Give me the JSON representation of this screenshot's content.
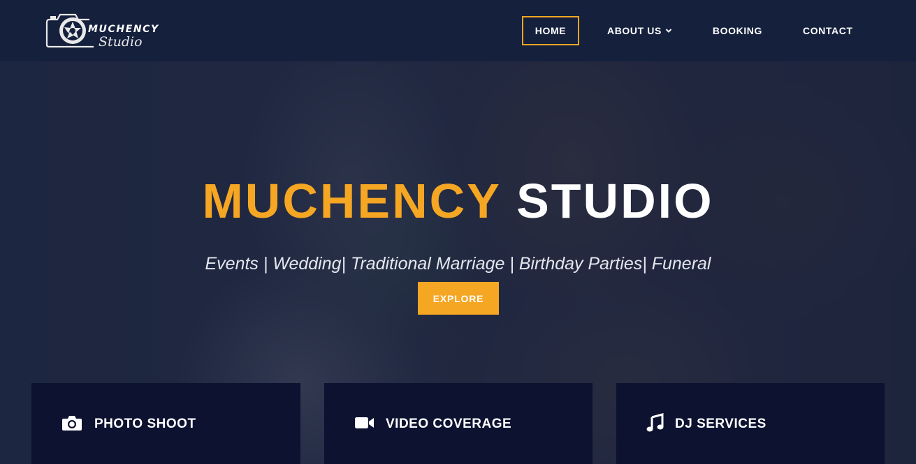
{
  "brand": {
    "wordmark": "MUCHENCY",
    "sub": "Studio"
  },
  "nav": {
    "items": [
      {
        "label": "HOME",
        "active": true
      },
      {
        "label": "ABOUT US",
        "has_dropdown": true
      },
      {
        "label": "BOOKING"
      },
      {
        "label": "CONTACT"
      }
    ]
  },
  "hero": {
    "title_accent": "MUCHENCY",
    "title_plain": "STUDIO",
    "tagline": "Events | Wedding| Traditional Marriage | Birthday Parties| Funeral",
    "cta_label": "EXPLORE"
  },
  "services": [
    {
      "label": "PHOTO SHOOT",
      "icon": "camera-icon"
    },
    {
      "label": "VIDEO COVERAGE",
      "icon": "video-camera-icon"
    },
    {
      "label": "DJ SERVICES",
      "icon": "music-note-icon"
    }
  ],
  "colors": {
    "accent": "#f5a623",
    "header_bg": "#15203d",
    "card_bg": "#0c1230",
    "text": "#ffffff"
  }
}
